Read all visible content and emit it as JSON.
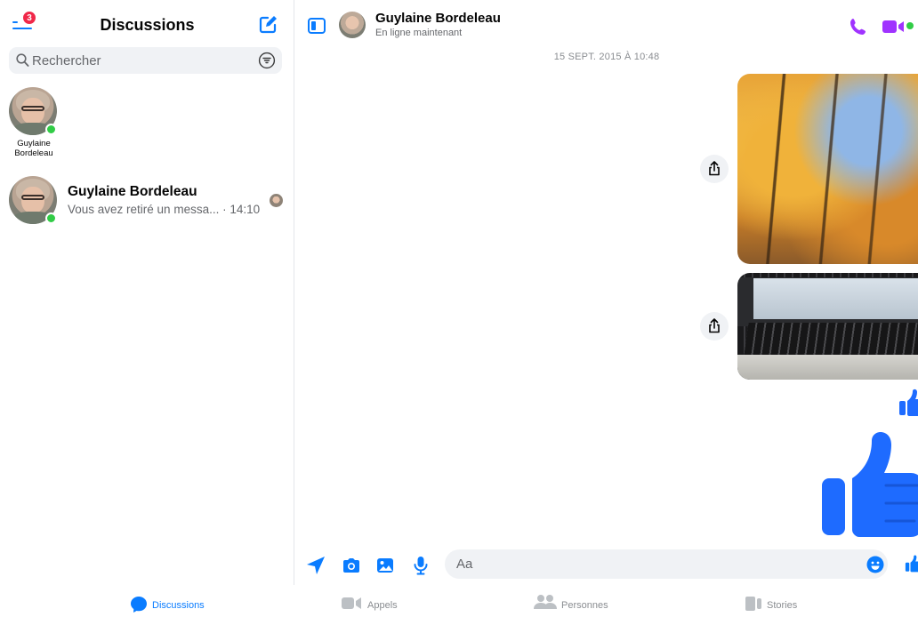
{
  "colors": {
    "accent": "#0a7cff",
    "call_purple": "#a033ff",
    "online": "#31cc46",
    "badge": "#f02849"
  },
  "sidebar": {
    "menu_badge_count": "3",
    "title": "Discussions",
    "search": {
      "placeholder": "Rechercher"
    },
    "stories": [
      {
        "name": "Guylaine Bordeleau",
        "online": true
      }
    ],
    "conversations": [
      {
        "name": "Guylaine Bordeleau",
        "preview": "Vous avez retiré un messa...",
        "time": "14:10",
        "online": true
      }
    ]
  },
  "chat": {
    "contact_name": "Guylaine Bordeleau",
    "contact_status": "En ligne maintenant",
    "timestamp": "15 SEPT. 2015 À 10:48",
    "messages": [
      {
        "type": "photo",
        "subject": "autumn-forest"
      },
      {
        "type": "photo",
        "subject": "laptop-keyboard"
      },
      {
        "type": "like",
        "size": "small"
      },
      {
        "type": "like",
        "size": "large"
      }
    ],
    "composer": {
      "placeholder": "Aa"
    }
  },
  "tabs": [
    {
      "label": "Discussions",
      "icon": "chat-bubble-icon",
      "active": true
    },
    {
      "label": "Appels",
      "icon": "video-camera-icon",
      "active": false
    },
    {
      "label": "Personnes",
      "icon": "people-icon",
      "active": false
    },
    {
      "label": "Stories",
      "icon": "stories-icon",
      "active": false
    }
  ]
}
